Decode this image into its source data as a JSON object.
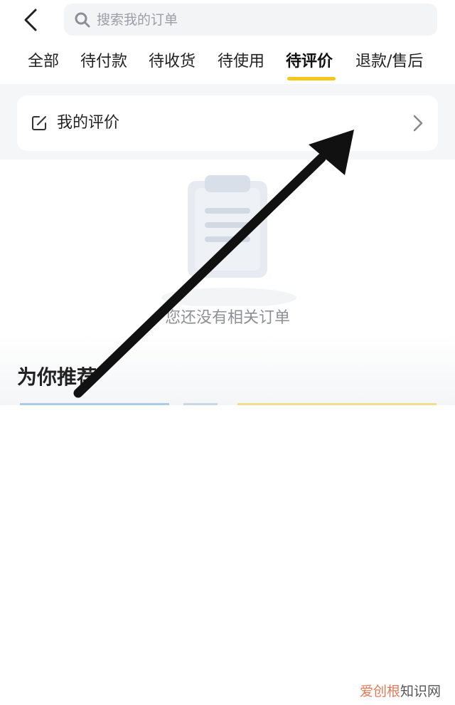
{
  "header": {
    "search_placeholder": "搜索我的订单"
  },
  "tabs": [
    {
      "label": "全部"
    },
    {
      "label": "待付款"
    },
    {
      "label": "待收货"
    },
    {
      "label": "待使用"
    },
    {
      "label": "待评价"
    },
    {
      "label": "退款/售后"
    }
  ],
  "active_tab": "待评价",
  "my_review": {
    "label": "我的评价"
  },
  "empty_state": {
    "text": "您还没有相关订单"
  },
  "recommend": {
    "title": "为你推荐"
  },
  "watermark": {
    "part1": "爱创根",
    "part2": "知识网"
  },
  "colors": {
    "accent": "#f6c71a",
    "background_gray": "#f5f6f8",
    "arrow": "#111111"
  },
  "icons": [
    "back-arrow-icon",
    "search-icon",
    "edit-icon",
    "chevron-right-icon",
    "clipboard-icon"
  ]
}
